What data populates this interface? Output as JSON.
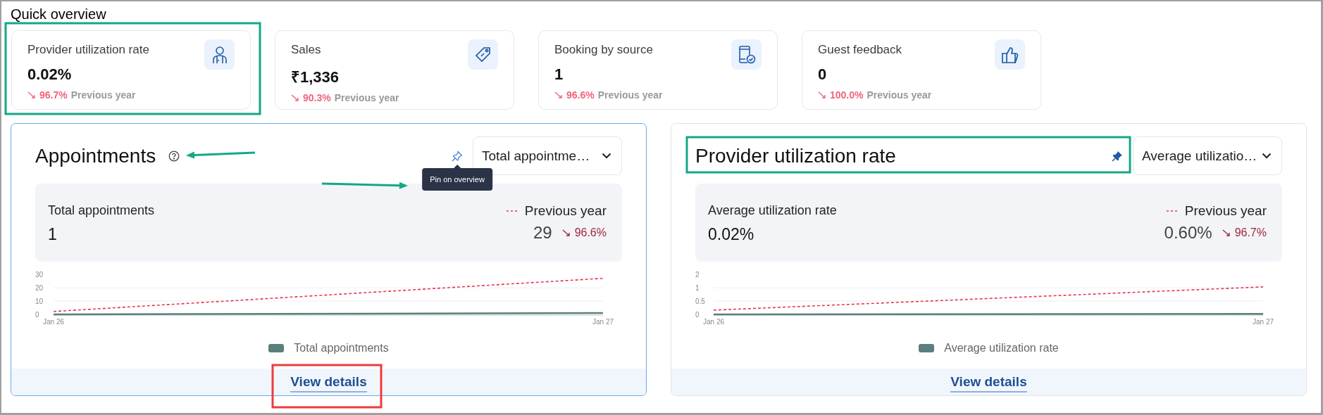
{
  "page_title": "Quick overview",
  "overview_cards": [
    {
      "title": "Provider utilization rate",
      "value": "0.02%",
      "change": "96.7%",
      "decreasing": true,
      "comparison": "Previous year"
    },
    {
      "title": "Sales",
      "value": "₹1,336",
      "change": "90.3%",
      "decreasing": true,
      "comparison": "Previous year"
    },
    {
      "title": "Booking by source",
      "value": "1",
      "change": "96.6%",
      "decreasing": true,
      "comparison": "Previous year"
    },
    {
      "title": "Guest feedback",
      "value": "0",
      "change": "100.0%",
      "decreasing": true,
      "comparison": "Previous year"
    }
  ],
  "panels": [
    {
      "title": "Appointments",
      "selected": true,
      "help": true,
      "pinned": false,
      "tooltip": "Pin on overview",
      "dropdown": "Total appointme…",
      "stats": {
        "label": "Total appointments",
        "value": "1",
        "comparison_label": "Previous year",
        "comparison_value": "29",
        "change": "96.6%",
        "decreasing": true
      },
      "chart_data": {
        "type": "line",
        "categories": [
          "Jan 26",
          "Jan 27"
        ],
        "ylim": [
          0,
          30
        ],
        "ref_lines": [
          {
            "axis": "y",
            "value": 10
          },
          {
            "axis": "y",
            "value": 20
          }
        ],
        "yticks": [
          0,
          10,
          20,
          30
        ],
        "series": [
          {
            "name": "Total appointments",
            "color": "#5b7f7c",
            "values": [
              0,
              1
            ]
          },
          {
            "color": "#e8364f",
            "line_style": "dashed",
            "values": [
              2.2,
              27
            ]
          }
        ]
      },
      "link": "View details"
    },
    {
      "title": "Provider utilization rate",
      "selected": false,
      "help": false,
      "pinned": true,
      "dropdown": "Average utilizatio…",
      "stats": {
        "label": "Average utilization rate",
        "value": "0.02%",
        "comparison_label": "Previous year",
        "comparison_value": "0.60%",
        "change": "96.7%",
        "decreasing": true
      },
      "chart_data": {
        "type": "line",
        "categories": [
          "Jan 26",
          "Jan 27"
        ],
        "ylim": [
          0,
          1.5
        ],
        "ref_lines": [
          {
            "axis": "y",
            "value": 0.5
          },
          {
            "axis": "y",
            "value": 1
          }
        ],
        "yticks": [
          0,
          0.5,
          1,
          {
            "value": 1.5,
            "label": "2"
          }
        ],
        "series": [
          {
            "name": "Average utilization rate",
            "color": "#5b7f7c",
            "values": [
              0,
              0.02
            ]
          },
          {
            "color": "#e8364f",
            "line_style": "dashed",
            "values": [
              0.16,
              1.03
            ]
          }
        ]
      },
      "link": "View details"
    }
  ],
  "annotations": [
    {
      "kind": "frame",
      "color": "#12a887"
    },
    {
      "kind": "arrow",
      "color": "#12a887"
    },
    {
      "kind": "arrow",
      "color": "#12a887"
    },
    {
      "kind": "frame",
      "color": "#12a887"
    },
    {
      "kind": "frame",
      "color": "#ee3b3b"
    }
  ]
}
